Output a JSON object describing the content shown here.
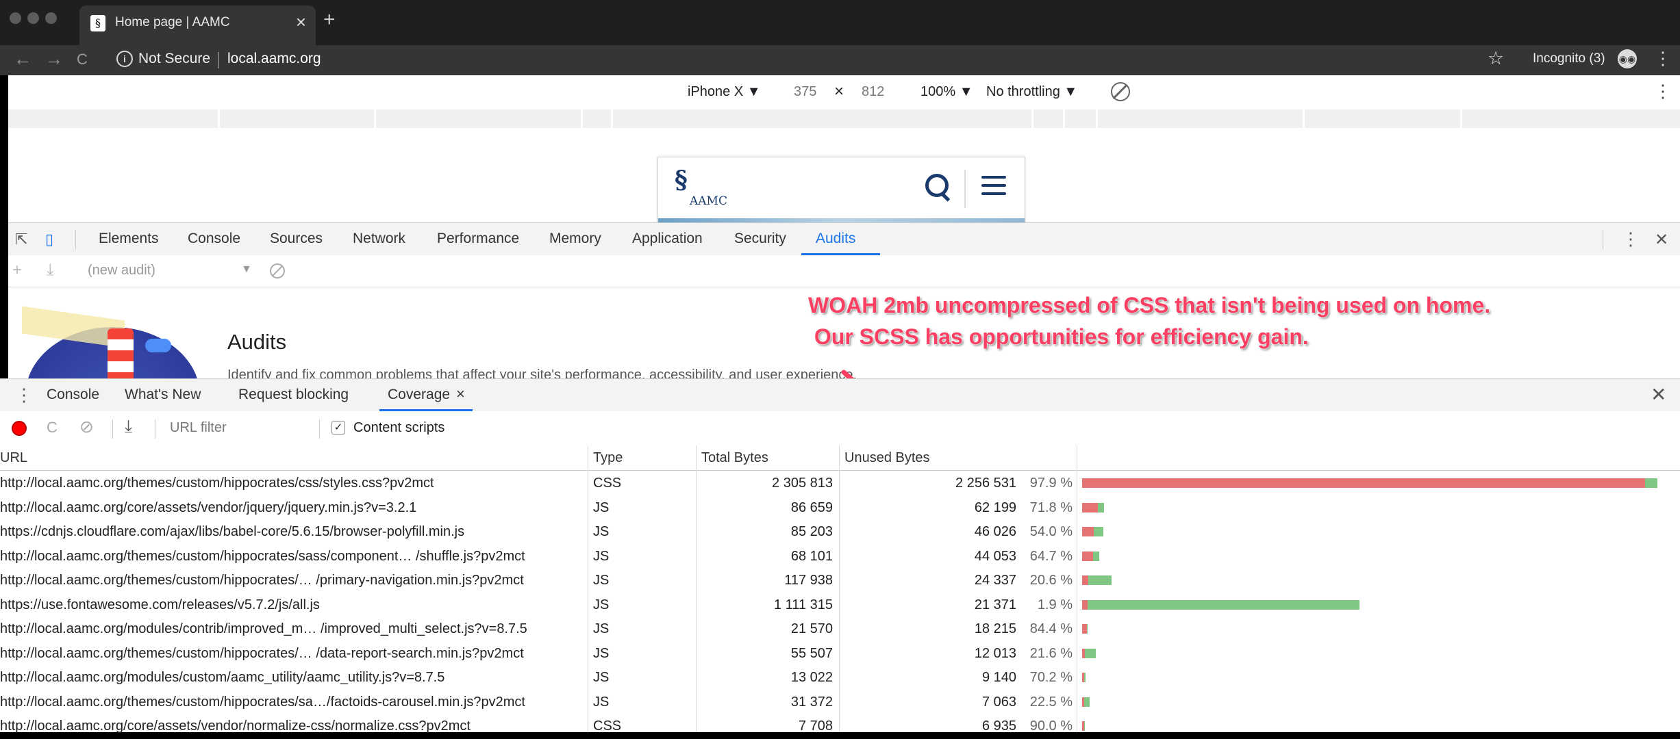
{
  "browser": {
    "tab_title": "Home page | AAMC",
    "favicon_glyph": "§",
    "close_glyph": "×",
    "new_tab_glyph": "+",
    "back_glyph": "←",
    "forward_glyph": "→",
    "reload_glyph": "C",
    "security_label": "Not Secure",
    "url": "local.aamc.org",
    "bookmark_glyph": "☆",
    "incognito_label": "Incognito (3)",
    "incognito_glyph": "◉◉",
    "menu_glyph": "⋮"
  },
  "device_toolbar": {
    "device": "iPhone X ▼",
    "width": "375",
    "times": "×",
    "height": "812",
    "zoom": "100% ▼",
    "throttling": "No throttling ▼",
    "menu_glyph": "⋮"
  },
  "site": {
    "logo_glyph": "§",
    "logo_text": "AAMC"
  },
  "devtools": {
    "tabs": [
      "Elements",
      "Console",
      "Sources",
      "Network",
      "Performance",
      "Memory",
      "Application",
      "Security",
      "Audits"
    ],
    "active_tab": "Audits",
    "inspect_glyph": "⇱",
    "device_glyph": "▯",
    "menu_glyph": "⋮",
    "close_glyph": "✕"
  },
  "audits": {
    "add_glyph": "+",
    "download_glyph": "⤓",
    "selector": "(new audit)",
    "arrow": "▼",
    "heading": "Audits",
    "blurb": "Identify and fix common problems that affect your site's performance, accessibility, and user experience."
  },
  "annotation": {
    "text": "WOAH 2mb uncompressed of CSS that isn't being used on home.\n Our SCSS has opportunities for efficiency gain.",
    "color": "#fb3f63"
  },
  "drawer": {
    "menu_glyph": "⋮",
    "tabs": [
      "Console",
      "What's New",
      "Request blocking",
      "Coverage"
    ],
    "coverage_close": "×",
    "close_glyph": "✕"
  },
  "coverage": {
    "reload_glyph": "C",
    "clear_glyph": "⊘",
    "export_glyph": "⤓",
    "filter_placeholder": "URL filter",
    "checkbox_glyph": "✓",
    "content_scripts": "Content scripts",
    "content_scripts_checked": true,
    "columns": [
      "URL",
      "Type",
      "Total Bytes",
      "Unused Bytes"
    ],
    "rows": [
      {
        "url": "http://local.aamc.org/themes/custom/hippocrates/css/styles.css?pv2mct",
        "type": "CSS",
        "total": "2 305 813",
        "unused": "2 256 531",
        "pct": "97.9 %",
        "total_num": 2305813,
        "unused_num": 2256531
      },
      {
        "url": "http://local.aamc.org/core/assets/vendor/jquery/jquery.min.js?v=3.2.1",
        "type": "JS",
        "total": "86 659",
        "unused": "62 199",
        "pct": "71.8 %",
        "total_num": 86659,
        "unused_num": 62199
      },
      {
        "url": "https://cdnjs.cloudflare.com/ajax/libs/babel-core/5.6.15/browser-polyfill.min.js",
        "type": "JS",
        "total": "85 203",
        "unused": "46 026",
        "pct": "54.0 %",
        "total_num": 85203,
        "unused_num": 46026
      },
      {
        "url": "http://local.aamc.org/themes/custom/hippocrates/sass/component… /shuffle.js?pv2mct",
        "type": "JS",
        "total": "68 101",
        "unused": "44 053",
        "pct": "64.7 %",
        "total_num": 68101,
        "unused_num": 44053
      },
      {
        "url": "http://local.aamc.org/themes/custom/hippocrates/… /primary-navigation.min.js?pv2mct",
        "type": "JS",
        "total": "117 938",
        "unused": "24 337",
        "pct": "20.6 %",
        "total_num": 117938,
        "unused_num": 24337
      },
      {
        "url": "https://use.fontawesome.com/releases/v5.7.2/js/all.js",
        "type": "JS",
        "total": "1 111 315",
        "unused": "21 371",
        "pct": "1.9 %",
        "total_num": 1111315,
        "unused_num": 21371
      },
      {
        "url": "http://local.aamc.org/modules/contrib/improved_m… /improved_multi_select.js?v=8.7.5",
        "type": "JS",
        "total": "21 570",
        "unused": "18 215",
        "pct": "84.4 %",
        "total_num": 21570,
        "unused_num": 18215
      },
      {
        "url": "http://local.aamc.org/themes/custom/hippocrates/… /data-report-search.min.js?pv2mct",
        "type": "JS",
        "total": "55 507",
        "unused": "12 013",
        "pct": "21.6 %",
        "total_num": 55507,
        "unused_num": 12013
      },
      {
        "url": "http://local.aamc.org/modules/custom/aamc_utility/aamc_utility.js?v=8.7.5",
        "type": "JS",
        "total": "13 022",
        "unused": "9 140",
        "pct": "70.2 %",
        "total_num": 13022,
        "unused_num": 9140
      },
      {
        "url": "http://local.aamc.org/themes/custom/hippocrates/sa…/factoids-carousel.min.js?pv2mct",
        "type": "JS",
        "total": "31 372",
        "unused": "7 063",
        "pct": "22.5 %",
        "total_num": 31372,
        "unused_num": 7063
      },
      {
        "url": "http://local.aamc.org/core/assets/vendor/normalize-css/normalize.css?pv2mct",
        "type": "CSS",
        "total": "7 708",
        "unused": "6 935",
        "pct": "90.0 %",
        "total_num": 7708,
        "unused_num": 6935
      }
    ]
  },
  "colors": {
    "unused_bar": "#e57373",
    "used_bar": "#81c784",
    "accent": "#1a73e8"
  }
}
